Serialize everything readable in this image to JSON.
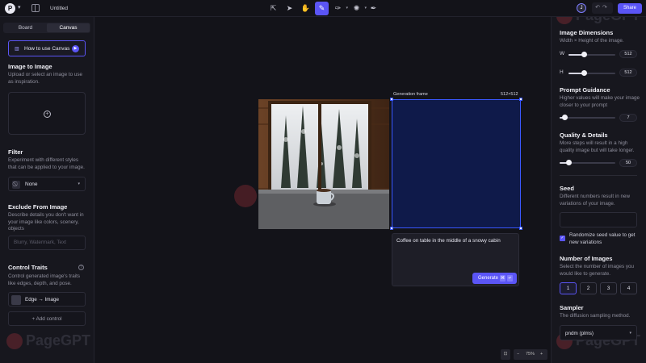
{
  "header": {
    "logo_letter": "P",
    "doc_title": "Untitled",
    "tools": [
      {
        "name": "select-tool-icon",
        "glyph": "⇱"
      },
      {
        "name": "pointer-tool-icon",
        "glyph": "➤"
      },
      {
        "name": "hand-tool-icon",
        "glyph": "✋"
      },
      {
        "name": "generate-tool-icon",
        "glyph": "✎"
      },
      {
        "name": "brush-tool-icon",
        "glyph": "✑"
      },
      {
        "name": "effects-tool-icon",
        "glyph": "✺"
      },
      {
        "name": "pen-tool-icon",
        "glyph": "✒"
      }
    ],
    "avatar_letter": "J",
    "undo_redo": "↶↷",
    "share_label": "Share"
  },
  "left_panel": {
    "tabs": [
      "Board",
      "Canvas"
    ],
    "active_tab": "Canvas",
    "howto_label": "How to use Canvas",
    "image_to_image": {
      "title": "Image to Image",
      "desc": "Upload or select an image to use as inspiration."
    },
    "filter": {
      "title": "Filter",
      "desc": "Experiment with different styles that can be applied to your image.",
      "value": "None"
    },
    "exclude": {
      "title": "Exclude From Image",
      "desc": "Describe details you don't want in your image like colors, scenery, objects",
      "placeholder": "Blurry, Watermark, Text"
    },
    "control_traits": {
      "title": "Control Traits",
      "desc": "Control generated image's traits like edges, depth, and pose.",
      "trait": "Edge → Image",
      "add_label": "+ Add control"
    }
  },
  "canvas": {
    "generation_frame_label": "Generation frame",
    "generation_frame_size": "512×512",
    "prompt": "Coffee on table in the middle of a snowy cabin",
    "generate_label": "Generate",
    "generate_keys": [
      "⌘",
      "↵"
    ],
    "zoom_fit_glyph": "⊡",
    "zoom_out": "−",
    "zoom_level": "75%",
    "zoom_in": "+"
  },
  "watermark": "PageGPT",
  "right_panel": {
    "dimensions": {
      "title": "Image Dimensions",
      "desc": "Width × Height of the image.",
      "width_label": "W",
      "width": "512",
      "height_label": "H",
      "height": "512",
      "width_fraction": 0.33,
      "height_fraction": 0.33
    },
    "guidance": {
      "title": "Prompt Guidance",
      "desc": "Higher values will make your image closer to your prompt",
      "value": "7",
      "fraction": 0.1
    },
    "quality": {
      "title": "Quality & Details",
      "desc": "More steps will result in a high quality image but will take longer.",
      "value": "50",
      "fraction": 0.16
    },
    "seed": {
      "title": "Seed",
      "desc": "Different numbers result in new variations of your image.",
      "randomize_label": "Randomize seed value to get new variations",
      "randomize_checked": true
    },
    "num_images": {
      "title": "Number of Images",
      "desc": "Select the number of images you would like to generate.",
      "options": [
        "1",
        "2",
        "3",
        "4"
      ],
      "selected": "1"
    },
    "sampler": {
      "title": "Sampler",
      "desc": "The diffusion sampling method.",
      "value": "pndm (plms)"
    }
  },
  "colors": {
    "accent": "#5b55f6",
    "background": "#131319",
    "panel": "#17171e",
    "generation_frame": "#0f1a4a",
    "frame_border": "#3a58ff"
  }
}
